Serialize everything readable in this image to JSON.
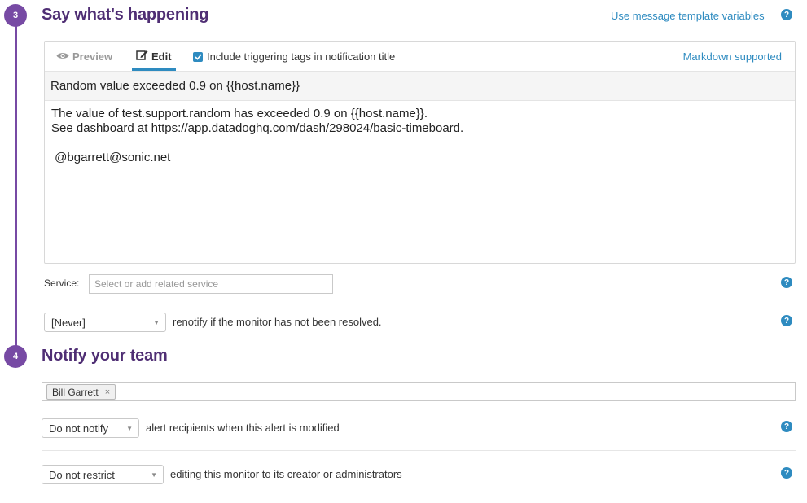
{
  "section3": {
    "step": "3",
    "title": "Say what's happening",
    "template_vars_link": "Use message template variables",
    "help": "?"
  },
  "editor": {
    "tab_preview": "Preview",
    "tab_edit": "Edit",
    "include_tags_label": "Include triggering tags in notification title",
    "include_tags_checked": true,
    "markdown_link": "Markdown supported",
    "title_value": "Random value exceeded 0.9 on {{host.name}}",
    "body_lines": [
      "The value of test.support.random has exceeded 0.9 on {{host.name}}.",
      "See dashboard at https://app.datadoghq.com/dash/298024/basic-timeboard.",
      "",
      " @bgarrett@sonic.net"
    ]
  },
  "service": {
    "label": "Service:",
    "placeholder": "Select or add related service",
    "help": "?"
  },
  "renotify": {
    "selected": "[Never]",
    "text": "renotify if the monitor has not been resolved.",
    "help": "?"
  },
  "section4": {
    "step": "4",
    "title": "Notify your team"
  },
  "recipients": {
    "chips": [
      {
        "label": "Bill Garrett",
        "remove": "×"
      }
    ]
  },
  "modified": {
    "selected": "Do not notify",
    "text": "alert recipients when this alert is modified",
    "help": "?"
  },
  "restrict": {
    "selected": "Do not restrict",
    "text": "editing this monitor to its creator or administrators",
    "help": "?"
  },
  "colors": {
    "step_purple": "#774aa4",
    "title_purple": "#4f2e74",
    "link_blue": "#2e8bc0"
  },
  "icons": {
    "preview": "eye-icon",
    "edit": "edit-icon",
    "help": "help-icon",
    "caret": "chevron-down-icon",
    "remove": "close-icon"
  }
}
